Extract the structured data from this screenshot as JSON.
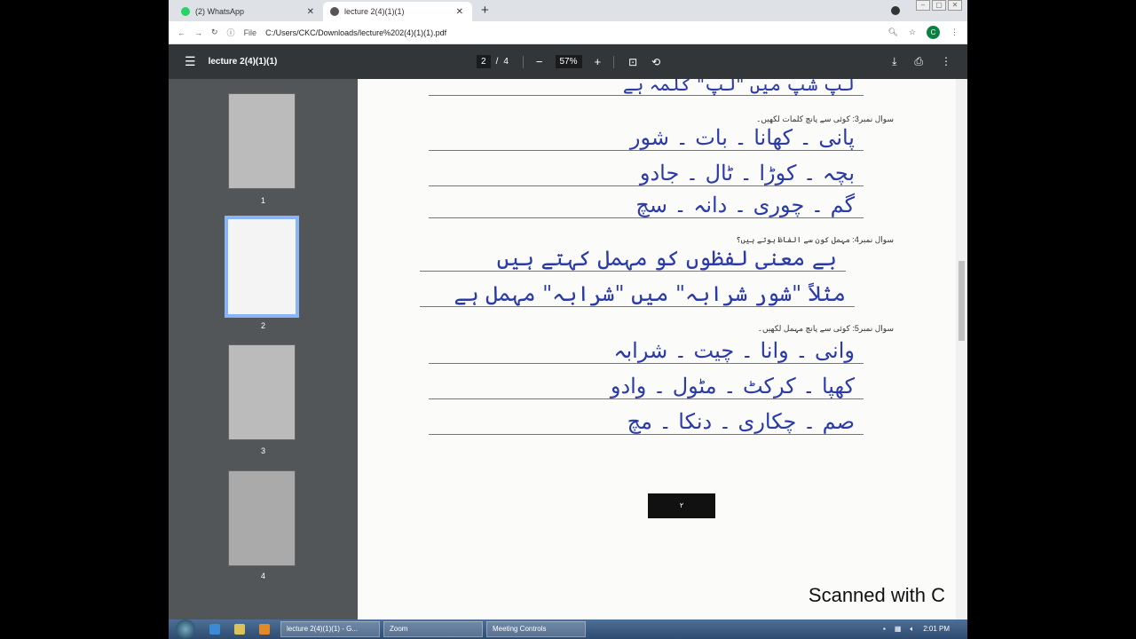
{
  "browser": {
    "tabs": [
      {
        "label": "(2) WhatsApp",
        "favicon": "whatsapp-icon",
        "color": "#25d366"
      },
      {
        "label": "lecture 2(4)(1)(1)",
        "favicon": "globe-icon"
      }
    ],
    "url_prefix": "File",
    "url": "C:/Users/CKC/Downloads/lecture%202(4)(1)(1).pdf",
    "profile_initial": "C"
  },
  "pdf": {
    "title": "lecture 2(4)(1)(1)",
    "current_page": "2",
    "page_sep": "/",
    "total_pages": "4",
    "zoom": "57%",
    "thumbnails": [
      {
        "label": "1"
      },
      {
        "label": "2",
        "selected": true
      },
      {
        "label": "3"
      },
      {
        "label": "4"
      }
    ]
  },
  "page": {
    "top_line": "لپ شپ میں \"لپ\" کلمہ ہے",
    "q3": "سوال نمبر3: کوئی سے پانچ کلمات لکھیں۔",
    "q3_lines": [
      "پانی ۔ کھانا ۔ بات ۔ شور",
      "بچہ ۔ کوڑا ۔ ٹال ۔ جادو",
      "گم ۔ چوری ۔ دانہ ۔ سچ"
    ],
    "q4": "سوال نمبر4: مہمل کون سے الفاظ ہوتے ہیں؟",
    "q4_lines": [
      "بے معنی لفظوں کو مہمل کہتے ہیں",
      "مثلاً \"شور شرابہ\" میں \"شرابہ\" مہمل ہے"
    ],
    "q5": "سوال نمبر5: کوئی سے پانچ مہمل لکھیں۔",
    "q5_lines": [
      "وانی ۔ وانا ۔ چیت ۔ شرابہ",
      "کھپا ۔ کرکٹ ۔ مٹول ۔ وادو",
      "صم ۔ چکاری ۔ دنکا ۔ مچ"
    ],
    "page_number": "۲",
    "watermark": "Scanned with C"
  },
  "taskbar": {
    "items": [
      "lecture 2(4)(1)(1) - G...",
      "Zoom",
      "Meeting Controls"
    ],
    "clock": "2:01 PM"
  }
}
